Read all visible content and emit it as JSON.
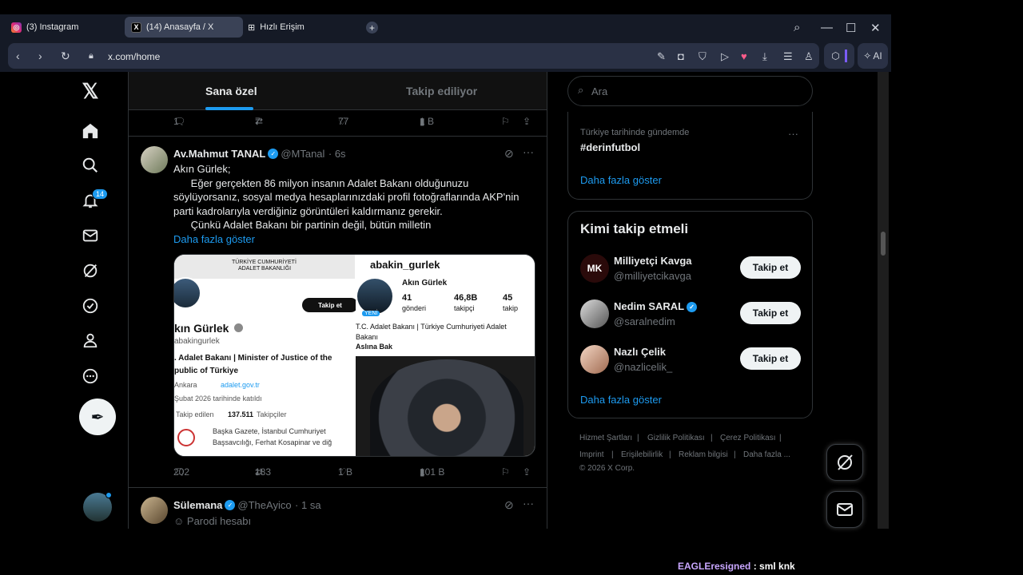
{
  "browser": {
    "tabs": [
      {
        "label": "(3) Instagram"
      },
      {
        "label": "(14) Anasayfa / X"
      },
      {
        "label": "Hızlı Erişim"
      }
    ],
    "url": "x.com/home",
    "ai_label": "AI"
  },
  "nav": {
    "notification_count": "14"
  },
  "feed": {
    "tabs": {
      "for_you": "Sana özel",
      "following": "Takip ediliyor"
    },
    "prev_actions": {
      "replies": "1",
      "reposts": "7",
      "likes": "77",
      "views": "1 B"
    },
    "tweet1": {
      "name": "Av.Mahmut TANAL",
      "handle": "@MTanal",
      "time": "· 6s",
      "lines": [
        "Akın Gürlek;",
        "      Eğer gerçekten 86 milyon insanın Adalet Bakanı olduğunuzu",
        "söylüyorsanız, sosyal medya hesaplarınızdaki profil fotoğraflarında AKP'nin",
        "parti kadrolarıyla verdiğiniz görüntüleri kaldırmanız gerekir.",
        "      Çünkü Adalet Bakanı bir partinin değil, bütün milletin"
      ],
      "show_more": "Daha fazla göster",
      "actions": {
        "replies": "202",
        "reposts": "183",
        "likes": "1 B",
        "views": "101 B"
      }
    },
    "media_left": {
      "header1": "TÜRKİYE CUMHURİYETİ",
      "header2": "ADALET BAKANLIĞI",
      "follow": "Takip et",
      "name": "kın Gürlek",
      "handle": "abakingurlek",
      "bio1": ". Adalet Bakanı | Minister of Justice of the",
      "bio2": "public of Türkiye",
      "location": "Ankara",
      "website": "adalet.gov.tr",
      "joined": "Şubat 2026 tarihinde katıldı",
      "following_label": "Takip edilen",
      "followers_count": "137.511",
      "followers_label": "Takipçiler",
      "followed_by1": "Başka Gazete, İstanbul Cumhuriyet",
      "followed_by2": "Başsavcılığı, Ferhat Kosapinar ve diğ"
    },
    "media_right": {
      "username": "abakin_gurlek",
      "name": "Akın Gürlek",
      "posts": "41",
      "posts_label": "gönderi",
      "followers": "46,8B",
      "followers_label": "takipçi",
      "following": "45",
      "following_label": "takip",
      "new_badge": "YENİ",
      "bio1": "T.C. Adalet Bakanı | Türkiye Cumhuriyeti Adalet",
      "bio2": "Bakanı",
      "bio3": "Aslına Bak"
    },
    "tweet2": {
      "name": "Sülemana",
      "handle": "@TheAyico",
      "time": "· 1 sa",
      "label": "Parodi hesabı"
    }
  },
  "sidebar": {
    "search_placeholder": "Ara",
    "trend": {
      "context": "Türkiye tarihinde gündemde",
      "tag": "#derinfutbol",
      "show_more": "Daha fazla göster"
    },
    "who_to_follow": {
      "title": "Kimi takip etmeli",
      "users": [
        {
          "name": "Milliyetçi Kavga",
          "handle": "@milliyetcikavga",
          "verified": false
        },
        {
          "name": "Nedim SARAL",
          "handle": "@saralnedim",
          "verified": true
        },
        {
          "name": "Nazlı Çelik",
          "handle": "@nazlicelik_",
          "verified": false
        }
      ],
      "follow_label": "Takip et",
      "show_more": "Daha fazla göster"
    },
    "footer": {
      "links": [
        "Hizmet Şartları",
        "Gizlilik Politikası",
        "Çerez Politikası",
        "Imprint",
        "Erişilebilirlik",
        "Reklam bilgisi",
        "Daha fazla ..."
      ],
      "copyright": "© 2026 X Corp."
    }
  },
  "overlay": {
    "chat_user": "EAGLEresigned",
    "chat_text": " : sml knk"
  },
  "colors": {
    "accent": "#1d9bf0",
    "chat_user": "#c9a7ff"
  }
}
